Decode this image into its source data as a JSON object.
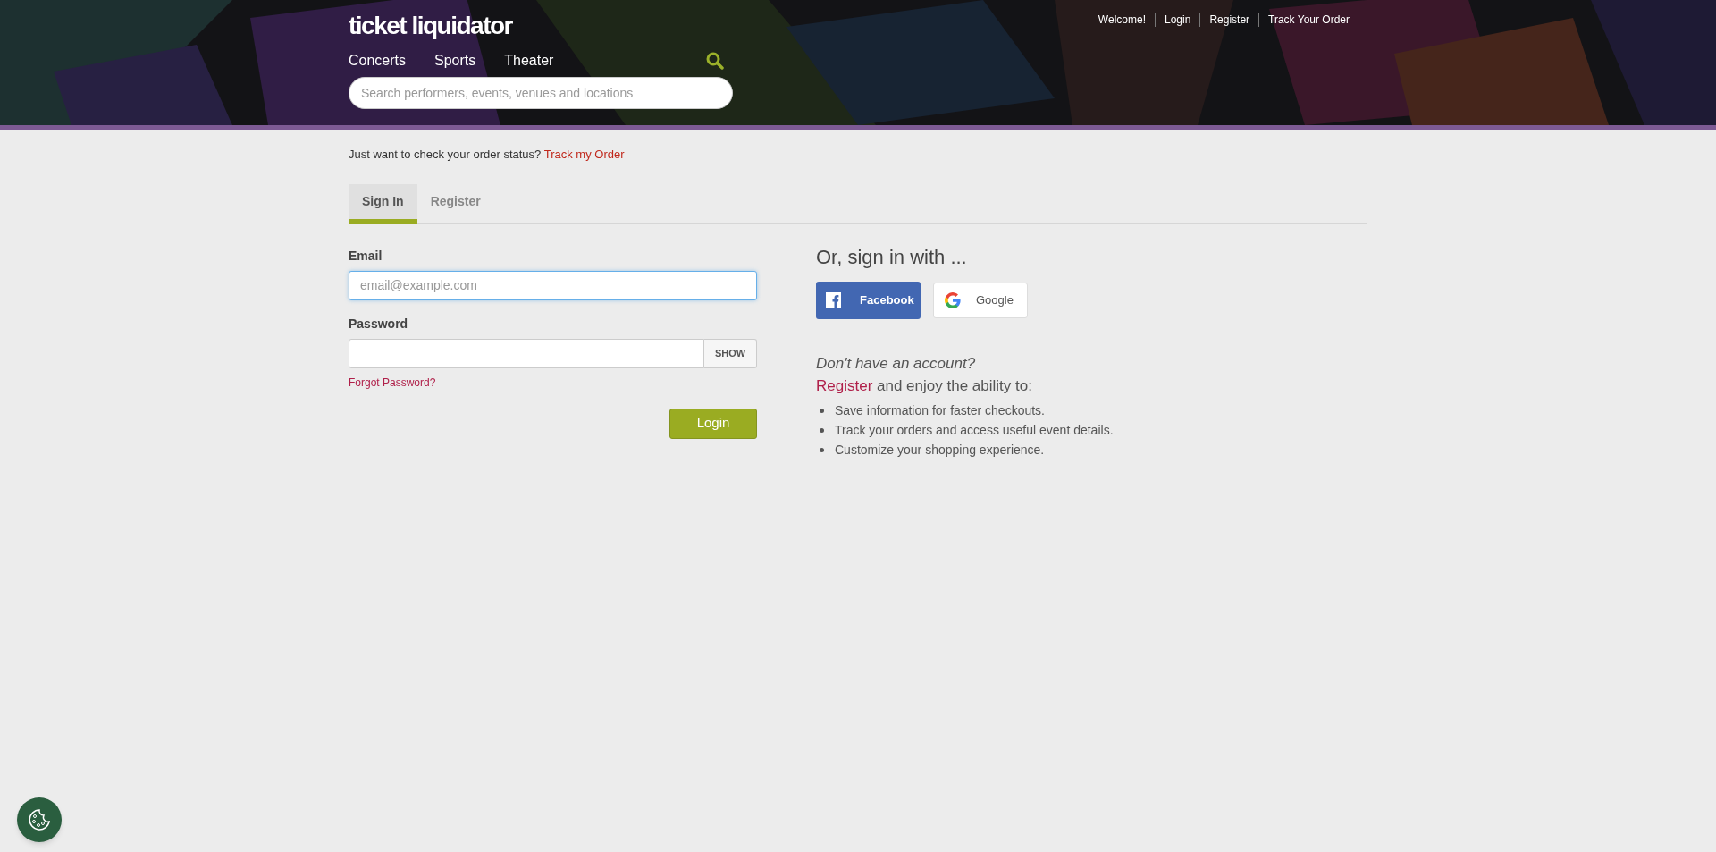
{
  "header": {
    "logo": "ticket liquidator",
    "nav": [
      "Concerts",
      "Sports",
      "Theater"
    ],
    "search": {
      "placeholder": "Search performers, events, venues and locations"
    },
    "top_links": [
      "Welcome!",
      "Login",
      "Register",
      "Track Your Order"
    ]
  },
  "order_status": {
    "text": "Just want to check your order status?",
    "link": "Track my Order"
  },
  "tabs": [
    {
      "label": "Sign In",
      "selected": true
    },
    {
      "label": "Register",
      "selected": false
    }
  ],
  "form": {
    "email": {
      "label": "Email",
      "placeholder": "email@example.com",
      "focused": true
    },
    "password": {
      "label": "Password",
      "show_button": "SHOW"
    },
    "forgot": "Forgot Password?",
    "submit": "Login"
  },
  "social": {
    "heading": "Or, sign in with ...",
    "buttons": [
      {
        "kind": "facebook",
        "label": "Facebook"
      },
      {
        "kind": "google",
        "label": "Google"
      }
    ]
  },
  "signup": {
    "question": "Don't have an account?",
    "link": "Register",
    "text": "and enjoy the ability to:",
    "benefits": [
      "Save information for faster checkouts.",
      "Track your orders and access useful event details.",
      "Customize your shopping experience."
    ]
  }
}
